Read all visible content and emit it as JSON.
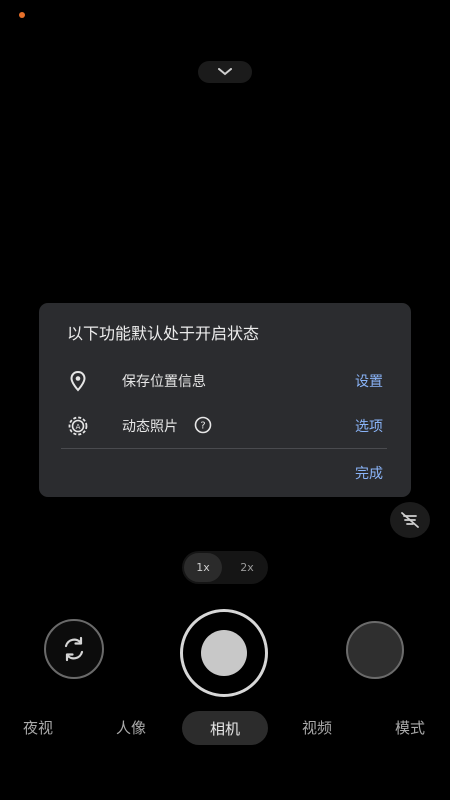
{
  "dialog": {
    "title": "以下功能默认处于开启状态",
    "rows": [
      {
        "label": "保存位置信息",
        "action": "设置",
        "icon": "location-pin-icon"
      },
      {
        "label": "动态照片",
        "action": "选项",
        "icon": "motion-photo-icon"
      }
    ],
    "done_label": "完成"
  },
  "zoom": {
    "options": [
      "1x",
      "2x"
    ],
    "selected": "1x"
  },
  "modes": {
    "items": [
      "夜视",
      "人像",
      "相机",
      "视频",
      "模式"
    ],
    "selected": "相机"
  },
  "colors": {
    "accent": "#8ab4f8",
    "dialog_bg": "#2b2c2f",
    "status_dot": "#e8702a"
  }
}
